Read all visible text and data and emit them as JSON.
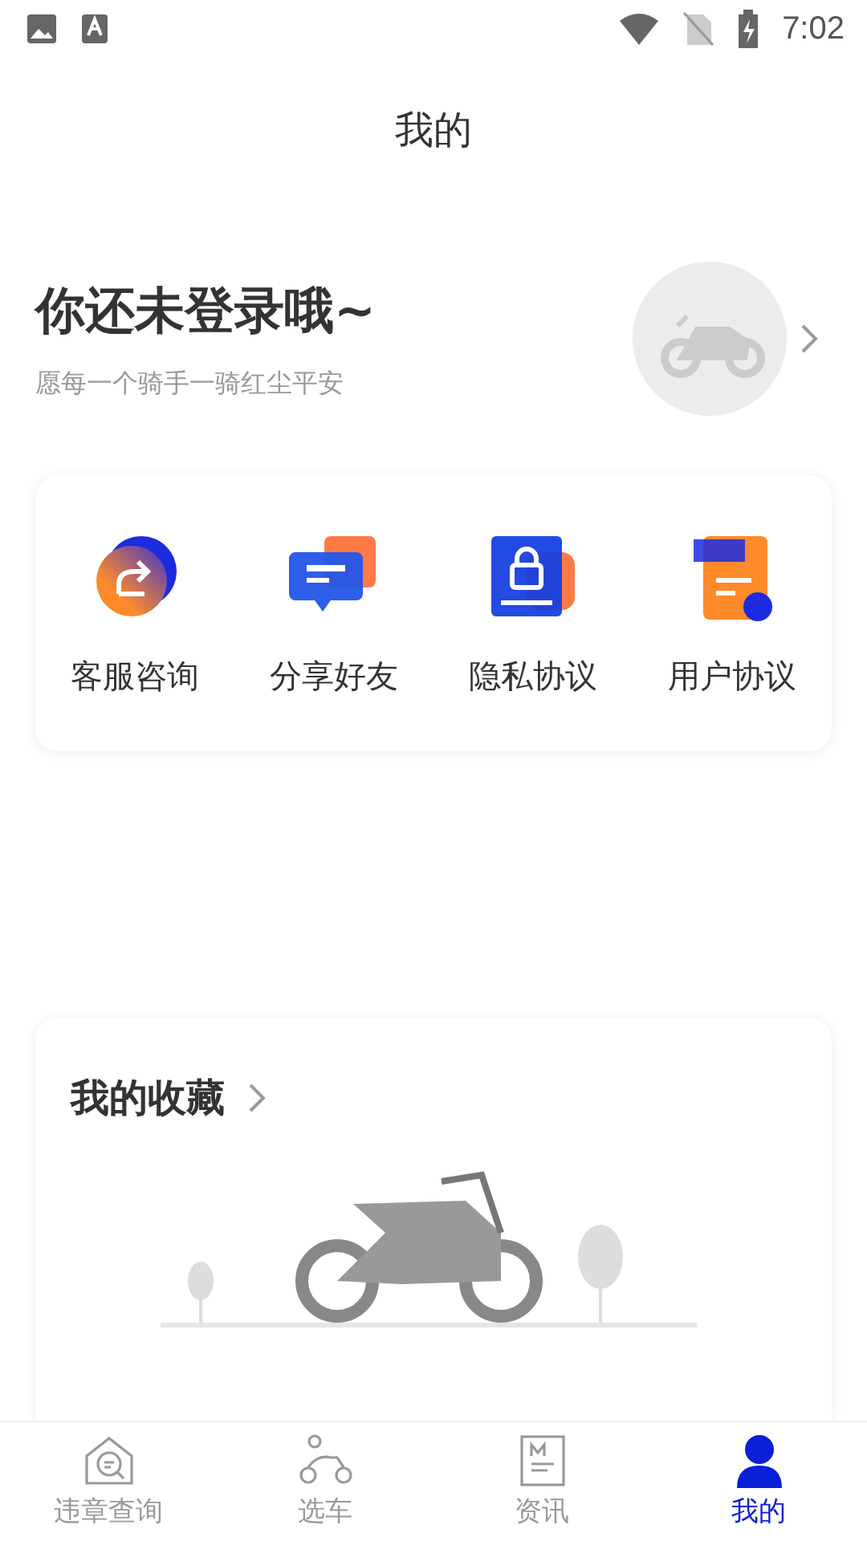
{
  "status_bar": {
    "time": "7:02"
  },
  "title": "我的",
  "profile": {
    "name": "你还未登录哦~",
    "subtitle": "愿每一个骑手一骑红尘平安"
  },
  "services": [
    {
      "kind": "service",
      "label": "客服咨询"
    },
    {
      "kind": "share",
      "label": "分享好友"
    },
    {
      "kind": "privacy",
      "label": "隐私协议"
    },
    {
      "kind": "terms",
      "label": "用户协议"
    }
  ],
  "favorites": {
    "title": "我的收藏"
  },
  "nav": [
    {
      "kind": "query",
      "label": "违章查询",
      "selected": false
    },
    {
      "kind": "car",
      "label": "选车",
      "selected": false
    },
    {
      "kind": "news",
      "label": "资讯",
      "selected": false
    },
    {
      "kind": "me",
      "label": "我的",
      "selected": true
    }
  ]
}
